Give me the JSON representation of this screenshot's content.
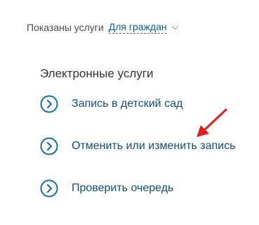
{
  "filter": {
    "label": "Показаны услуги",
    "value": "Для граждан"
  },
  "section": {
    "title": "Электронные услуги"
  },
  "services": [
    {
      "label": "Запись в детский сад"
    },
    {
      "label": "Отменить или изменить запись"
    },
    {
      "label": "Проверить очередь"
    }
  ],
  "colors": {
    "link": "#0f4f78",
    "icon": "#1a6fa0",
    "annotation_arrow": "#e02020"
  },
  "icons": {
    "service": "chevron-right-circle-icon",
    "filter": "chevron-down-icon",
    "annotation": "red-arrow"
  }
}
